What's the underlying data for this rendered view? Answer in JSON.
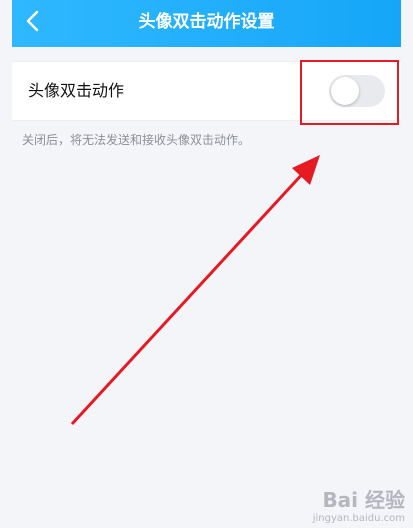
{
  "header": {
    "title": "头像双击动作设置",
    "back_icon": "chevron-left-icon"
  },
  "setting": {
    "label": "头像双击动作",
    "toggle_state": "off",
    "hint": "关闭后，将无法发送和接收头像双击动作。"
  },
  "colors": {
    "header": "#1aa9f9",
    "annotation": "#e61a23"
  },
  "watermark": {
    "brand": "Bai 经验",
    "url": "jingyan.baidu.com"
  }
}
